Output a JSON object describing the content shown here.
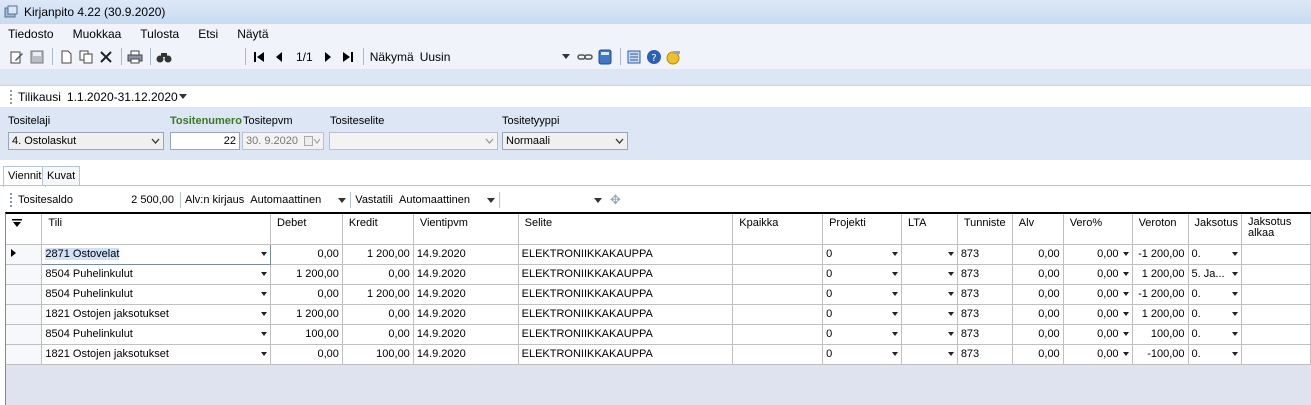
{
  "window": {
    "title": "Kirjanpito 4.22  (30.9.2020)"
  },
  "menu": [
    "Tiedosto",
    "Muokkaa",
    "Tulosta",
    "Etsi",
    "Näytä"
  ],
  "toolbar": {
    "page_indicator": "1/1",
    "view_label": "Näkymä",
    "view_value": "Uusin"
  },
  "period": {
    "label": "Tilikausi",
    "value": "1.1.2020-31.12.2020"
  },
  "form": {
    "tositelaji_label": "Tositelaji",
    "tositelaji_value": "4. Ostolaskut",
    "tositenumero_label": "Tositenumero",
    "tositenumero_value": "22",
    "tositepvm_label": "Tositepvm",
    "tositepvm_value": "30.  9.2020",
    "tositeselite_label": "Tositeselite",
    "tositeselite_value": "",
    "tositetyyppi_label": "Tositetyyppi",
    "tositetyyppi_value": "Normaali"
  },
  "tabs": [
    "Viennit",
    "Kuvat"
  ],
  "saldo": {
    "label": "Tositesaldo",
    "value": "2 500,00",
    "alv_label": "Alv:n kirjaus",
    "alv_value": "Automaattinen",
    "vastatili_label": "Vastatili",
    "vastatili_value": "Automaattinen"
  },
  "table": {
    "columns": [
      "Tili",
      "Debet",
      "Kredit",
      "Vientipvm",
      "Selite",
      "Kpaikka",
      "Projekti",
      "LTA",
      "Tunniste",
      "Alv",
      "Vero%",
      "Veroton",
      "Jaksotus",
      "Jaksotus alkaa"
    ],
    "rows": [
      [
        "2871 Ostovelat",
        "0,00",
        "1 200,00",
        "14.9.2020",
        "ELEKTRONIIKKAKAUPPA",
        "",
        "0",
        "",
        "873",
        "0,00",
        "0,00",
        "-1 200,00",
        "0.",
        ""
      ],
      [
        "8504 Puhelinkulut",
        "1 200,00",
        "0,00",
        "14.9.2020",
        "ELEKTRONIIKKAKAUPPA",
        "",
        "0",
        "",
        "873",
        "0,00",
        "0,00",
        "1 200,00",
        "5. Ja...",
        ""
      ],
      [
        "8504 Puhelinkulut",
        "0,00",
        "1 200,00",
        "14.9.2020",
        "ELEKTRONIIKKAKAUPPA",
        "",
        "0",
        "",
        "873",
        "0,00",
        "0,00",
        "-1 200,00",
        "0.",
        ""
      ],
      [
        "1821 Ostojen jaksotukset",
        "1 200,00",
        "0,00",
        "14.9.2020",
        "ELEKTRONIIKKAKAUPPA",
        "",
        "0",
        "",
        "873",
        "0,00",
        "0,00",
        "1 200,00",
        "0.",
        ""
      ],
      [
        "8504 Puhelinkulut",
        "100,00",
        "0,00",
        "14.9.2020",
        "ELEKTRONIIKKAKAUPPA",
        "",
        "0",
        "",
        "873",
        "0,00",
        "0,00",
        "100,00",
        "0.",
        ""
      ],
      [
        "1821 Ostojen jaksotukset",
        "0,00",
        "100,00",
        "14.9.2020",
        "ELEKTRONIIKKAKAUPPA",
        "",
        "0",
        "",
        "873",
        "0,00",
        "0,00",
        "-100,00",
        "0.",
        ""
      ]
    ]
  },
  "icons": [
    "app-icon",
    "edit-icon",
    "save-icon",
    "new-icon",
    "copy-icon",
    "delete-icon",
    "print-icon",
    "search-icon",
    "first-icon",
    "prev-icon",
    "next-icon",
    "last-icon",
    "link-icon",
    "calculator-icon",
    "list-icon",
    "help-icon",
    "key-icon"
  ]
}
